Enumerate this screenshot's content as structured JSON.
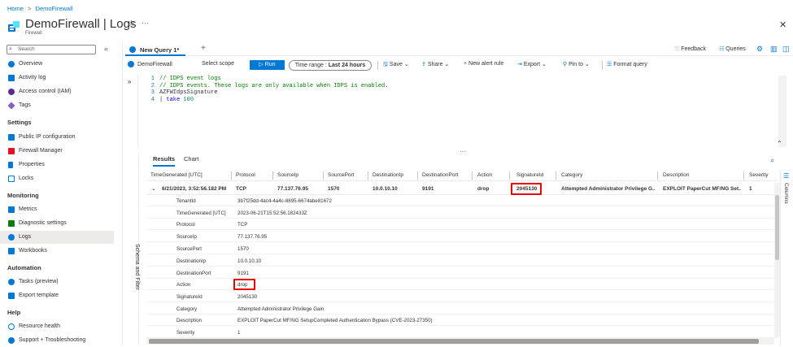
{
  "breadcrumb": {
    "home": "Home",
    "sep": ">",
    "resource": "DemoFirewall"
  },
  "header": {
    "title": "DemoFirewall | Logs",
    "subtitle": "Firewall",
    "star": "☆",
    "more": "···",
    "close": "✕"
  },
  "sidebar": {
    "search_placeholder": "Search",
    "collapse": "«",
    "items_top": [
      {
        "label": "Overview",
        "icon": "overview-icon",
        "color": "#0078d4"
      },
      {
        "label": "Activity log",
        "icon": "activity-log-icon",
        "color": "#0078d4"
      },
      {
        "label": "Access control (IAM)",
        "icon": "iam-icon",
        "color": "#5c2d91"
      },
      {
        "label": "Tags",
        "icon": "tags-icon",
        "color": "#8661c5"
      }
    ],
    "section_settings": "Settings",
    "items_settings": [
      {
        "label": "Public IP configuration",
        "icon": "public-ip-icon",
        "color": "#0078d4"
      },
      {
        "label": "Firewall Manager",
        "icon": "firewall-manager-icon",
        "color": "#e81123"
      },
      {
        "label": "Properties",
        "icon": "properties-icon",
        "color": "#0078d4"
      },
      {
        "label": "Locks",
        "icon": "lock-icon",
        "color": "#0078d4"
      }
    ],
    "section_monitoring": "Monitoring",
    "items_monitoring": [
      {
        "label": "Metrics",
        "icon": "metrics-icon",
        "color": "#0078d4"
      },
      {
        "label": "Diagnostic settings",
        "icon": "diagnostic-settings-icon",
        "color": "#107c10"
      },
      {
        "label": "Logs",
        "icon": "logs-icon",
        "color": "#0078d4"
      },
      {
        "label": "Workbooks",
        "icon": "workbooks-icon",
        "color": "#0078d4"
      }
    ],
    "section_automation": "Automation",
    "items_automation": [
      {
        "label": "Tasks (preview)",
        "icon": "tasks-icon",
        "color": "#0078d4"
      },
      {
        "label": "Export template",
        "icon": "export-template-icon",
        "color": "#0078d4"
      }
    ],
    "section_help": "Help",
    "items_help": [
      {
        "label": "Resource health",
        "icon": "resource-health-icon",
        "color": "#0078d4"
      },
      {
        "label": "Support + Troubleshooting",
        "icon": "support-icon",
        "color": "#0078d4"
      }
    ]
  },
  "tabs": {
    "query_tab": "New Query 1*",
    "add": "+",
    "feedback": "Feedback",
    "queries": "Queries"
  },
  "toolbar": {
    "scope_name": "DemoFirewall",
    "select_scope": "Select scope",
    "run": "▷ Run",
    "time_range_label": "Time range : ",
    "time_range_value": "Last 24 hours",
    "save": "Save ⌄",
    "share": "Share ⌄",
    "new_alert": "New alert rule",
    "export": "Export ⌄",
    "pin": "Pin to ⌄",
    "format": "Format query"
  },
  "editor": {
    "lines": [
      {
        "num": "1",
        "text": "// IDPS event logs"
      },
      {
        "num": "2",
        "text": "// IDPS events. These logs are only available when IDPS is enabled."
      },
      {
        "num": "3",
        "text": "AZFWIdpsSignature"
      },
      {
        "num": "4",
        "pipe": "| ",
        "kw": "take",
        "val": " 100"
      }
    ]
  },
  "schema_label": "Schema and Filter",
  "results": {
    "tab_results": "Results",
    "tab_chart": "Chart",
    "columns_label": "Columns",
    "headers": [
      "TimeGenerated [UTC]",
      "Protocol",
      "SourceIp",
      "SourcePort",
      "DestinationIp",
      "DestinationPort",
      "Action",
      "SignatureId",
      "Category",
      "Description",
      "Severity"
    ],
    "row": {
      "time": "6/21/2023, 3:52:56.182 PM",
      "protocol": "TCP",
      "source_ip": "77.137.76.95",
      "source_port": "1570",
      "dest_ip": "10.0.10.10",
      "dest_port": "9191",
      "action": "drop",
      "signature_id": "2045130",
      "category": "Attempted Administrator Privilege G...",
      "description": "EXPLOIT PaperCut MF/NG Set...",
      "severity": "1"
    },
    "details": [
      {
        "key": "TenantId",
        "value": "3b7f25dd-4ac4-4a4c-8895-6674abe81672"
      },
      {
        "key": "TimeGenerated [UTC]",
        "value": "2023-06-21T15:52:56.182433Z"
      },
      {
        "key": "Protocol",
        "value": "TCP"
      },
      {
        "key": "SourceIp",
        "value": "77.137.76.95"
      },
      {
        "key": "SourcePort",
        "value": "1570"
      },
      {
        "key": "DestinationIp",
        "value": "10.0.10.10"
      },
      {
        "key": "DestinationPort",
        "value": "9191"
      },
      {
        "key": "Action",
        "value": "drop"
      },
      {
        "key": "SignatureId",
        "value": "2045130"
      },
      {
        "key": "Category",
        "value": "Attempted Administrator Privilege Gain"
      },
      {
        "key": "Description",
        "value": "EXPLOIT PaperCut MF/NG SetupCompleted Authentication Bypass (CVE-2023-27350)"
      },
      {
        "key": "Severity",
        "value": "1"
      }
    ]
  },
  "colors": {
    "accent": "#0078d4",
    "highlight": "#e00000"
  }
}
